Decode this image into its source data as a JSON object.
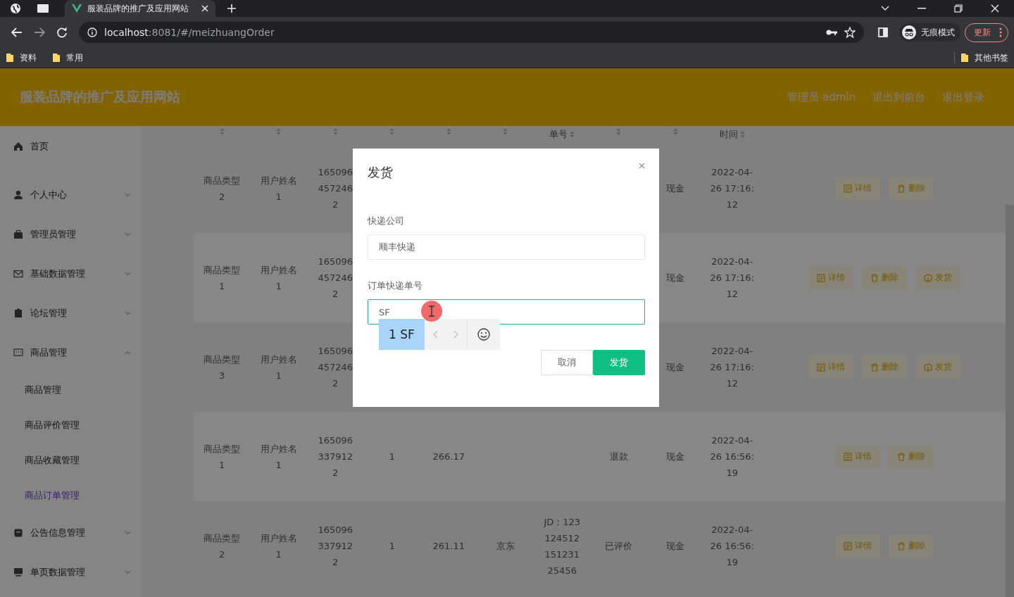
{
  "browser": {
    "tab_title": "服装品牌的推广及应用网站",
    "url": {
      "host": "localhost",
      "rest": ":8081/#/meizhuangOrder"
    },
    "profile": "无痕模式",
    "update": "更新",
    "bookmarks": [
      "资料",
      "常用"
    ],
    "other_bookmarks": "其他书签"
  },
  "header": {
    "title": "服装品牌的推广及应用网站",
    "links": [
      "管理员 admin",
      "退出到前台",
      "退出登录"
    ]
  },
  "sidebar": {
    "items": [
      {
        "label": "首页",
        "selected": false
      },
      {
        "label": "个人中心",
        "selected": false,
        "expanded": false
      },
      {
        "label": "管理员管理",
        "selected": false,
        "expanded": false
      },
      {
        "label": "基础数据管理",
        "selected": false,
        "expanded": false
      },
      {
        "label": "论坛管理",
        "selected": false,
        "expanded": false
      },
      {
        "label": "商品管理",
        "selected": false,
        "expanded": true,
        "children": [
          {
            "label": "商品管理",
            "selected": false
          },
          {
            "label": "商品评价管理",
            "selected": false
          },
          {
            "label": "商品收藏管理",
            "selected": false
          },
          {
            "label": "商品订单管理",
            "selected": true
          }
        ]
      },
      {
        "label": "公告信息管理",
        "selected": false,
        "expanded": false
      },
      {
        "label": "单页数据管理",
        "selected": false,
        "expanded": false
      }
    ]
  },
  "table": {
    "columns": [
      {},
      {},
      {},
      {},
      {},
      {},
      {
        "label": "单号"
      },
      {},
      {},
      {
        "label": "时间"
      }
    ],
    "rows": [
      {
        "cells": [
          "商品类型2",
          "用户姓名1",
          "1650964572462",
          "",
          "",
          "",
          "",
          "",
          "现金",
          "2022-04-26 17:16:12"
        ],
        "actions": [
          {
            "kind": "detail",
            "label": "详情"
          },
          {
            "kind": "delete",
            "label": "删除"
          }
        ]
      },
      {
        "cells": [
          "商品类型1",
          "用户姓名1",
          "1650964572462",
          "",
          "",
          "",
          "",
          "",
          "现金",
          "2022-04-26 17:16:12"
        ],
        "actions": [
          {
            "kind": "detail",
            "label": "详情"
          },
          {
            "kind": "delete",
            "label": "删除"
          },
          {
            "kind": "ship",
            "label": "发货"
          }
        ]
      },
      {
        "cells": [
          "商品类型3",
          "用户姓名1",
          "1650964572462",
          "",
          "",
          "",
          "",
          "",
          "现金",
          "2022-04-26 17:16:12"
        ],
        "actions": [
          {
            "kind": "detail",
            "label": "详情"
          },
          {
            "kind": "delete",
            "label": "删除"
          },
          {
            "kind": "ship",
            "label": "发货"
          }
        ]
      },
      {
        "cells": [
          "商品类型1",
          "用户姓名1",
          "1650963379122",
          "1",
          "266.17",
          "",
          "",
          "退款",
          "现金",
          "2022-04-26 16:56:19"
        ],
        "actions": [
          {
            "kind": "detail",
            "label": "详情"
          },
          {
            "kind": "delete",
            "label": "删除"
          }
        ]
      },
      {
        "cells": [
          "商品类型2",
          "用户姓名1",
          "1650963379122",
          "1",
          "261.11",
          "京东",
          "JD：12312451215123125456",
          "已评价",
          "现金",
          "2022-04-26 16:56:19"
        ],
        "actions": [
          {
            "kind": "detail",
            "label": "详情"
          },
          {
            "kind": "delete",
            "label": "删除"
          }
        ]
      }
    ]
  },
  "dialog": {
    "title": "发货",
    "fields": [
      {
        "label": "快递公司",
        "value": "顺丰快递",
        "focused": false
      },
      {
        "label": "订单快递单号",
        "value": "SF",
        "focused": true
      }
    ],
    "ime": {
      "candidates": [
        {
          "index": "1",
          "text": "SF",
          "selected": true
        }
      ]
    },
    "buttons": [
      {
        "kind": "cancel",
        "label": "取消"
      },
      {
        "kind": "primary",
        "label": "发货"
      }
    ]
  }
}
